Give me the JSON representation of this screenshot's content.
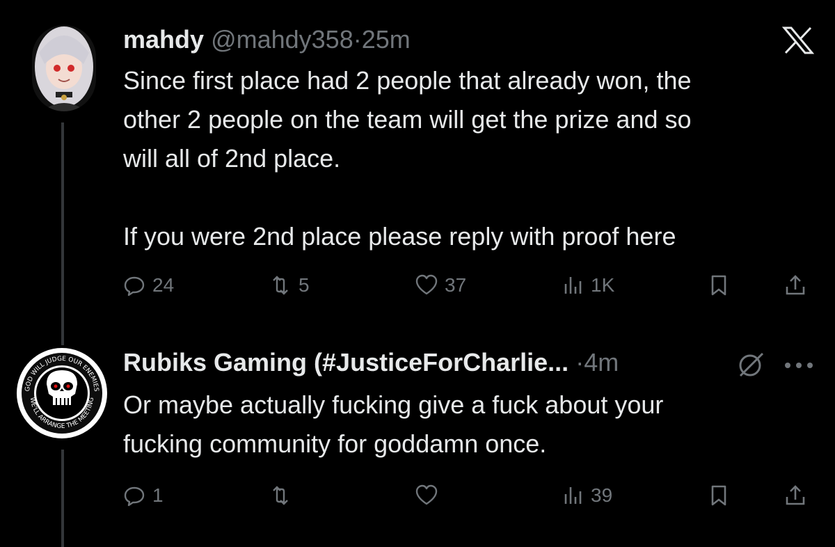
{
  "tweets": [
    {
      "display_name": "mahdy",
      "handle": "@mahdy358",
      "separator": "·",
      "time": "25m",
      "text_lines": [
        "Since first place had 2 people that already won, the",
        "other 2 people on the team will get the prize and so",
        "will all of 2nd place."
      ],
      "text_line2": "If you were 2nd place please reply with proof here",
      "replies": "24",
      "reposts": "5",
      "likes": "37",
      "views": "1K",
      "corner_icon": "x-logo-icon"
    },
    {
      "display_name": "Rubiks Gaming (#JusticeForCharlie...",
      "separator": "·",
      "time": "4m",
      "text_lines": [
        "Or maybe actually fucking give a fuck about your",
        "fucking community for goddamn once."
      ],
      "replies": "1",
      "reposts": "",
      "likes": "",
      "views": "39",
      "badge_text_top": "GOD WILL JUDGE OUR ENEMIES",
      "badge_text_bottom": "WE'LL ARRANGE THE MEETING"
    }
  ],
  "colors": {
    "background": "#000000",
    "text": "#e7e9ea",
    "muted": "#71767b",
    "thread_line": "#333639"
  }
}
